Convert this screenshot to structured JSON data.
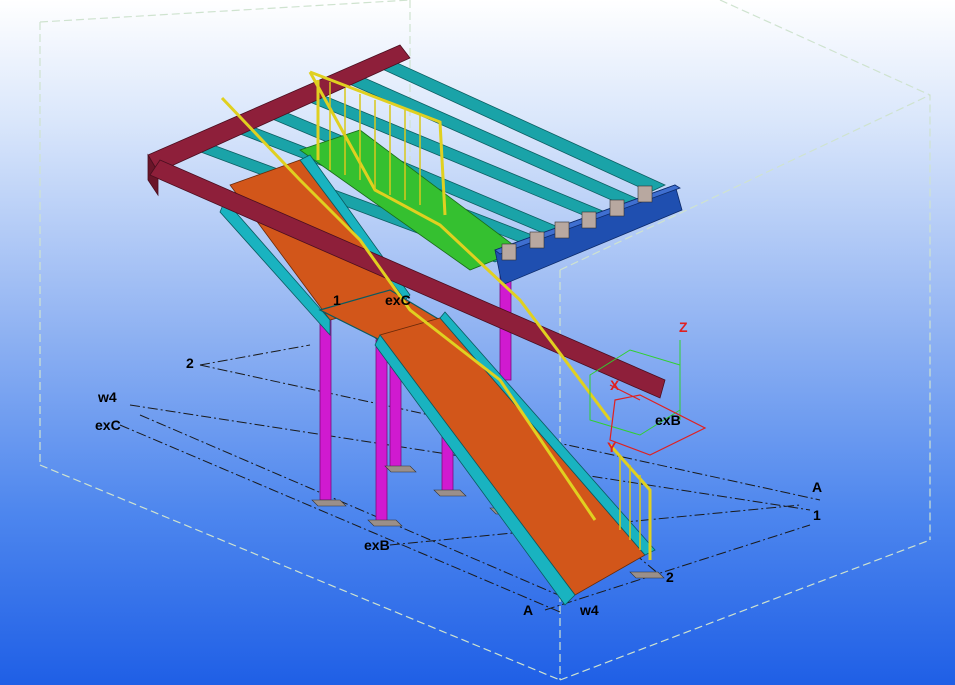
{
  "grid_labels": {
    "top_left_1": "1",
    "top_exc": "exC",
    "left_2": "2",
    "left_w4": "w4",
    "left_exc": "exC",
    "right_exb": "exB",
    "right_a": "A",
    "right_1": "1",
    "bottom_exb": "exB",
    "bottom_a": "A",
    "bottom_w4": "w4",
    "bottom_2": "2"
  },
  "axis_labels": {
    "z": "Z",
    "x": "X",
    "y": "Y"
  },
  "colors": {
    "beam_red": "#8e1f3a",
    "joist_teal": "#1aa3a8",
    "beam_blue": "#1f4fb0",
    "column_magenta": "#d01ad0",
    "stringer_cyan": "#19b3c0",
    "tread_orange": "#d2561a",
    "handrail_yellow": "#e0d020",
    "landing_green": "#35c030"
  }
}
